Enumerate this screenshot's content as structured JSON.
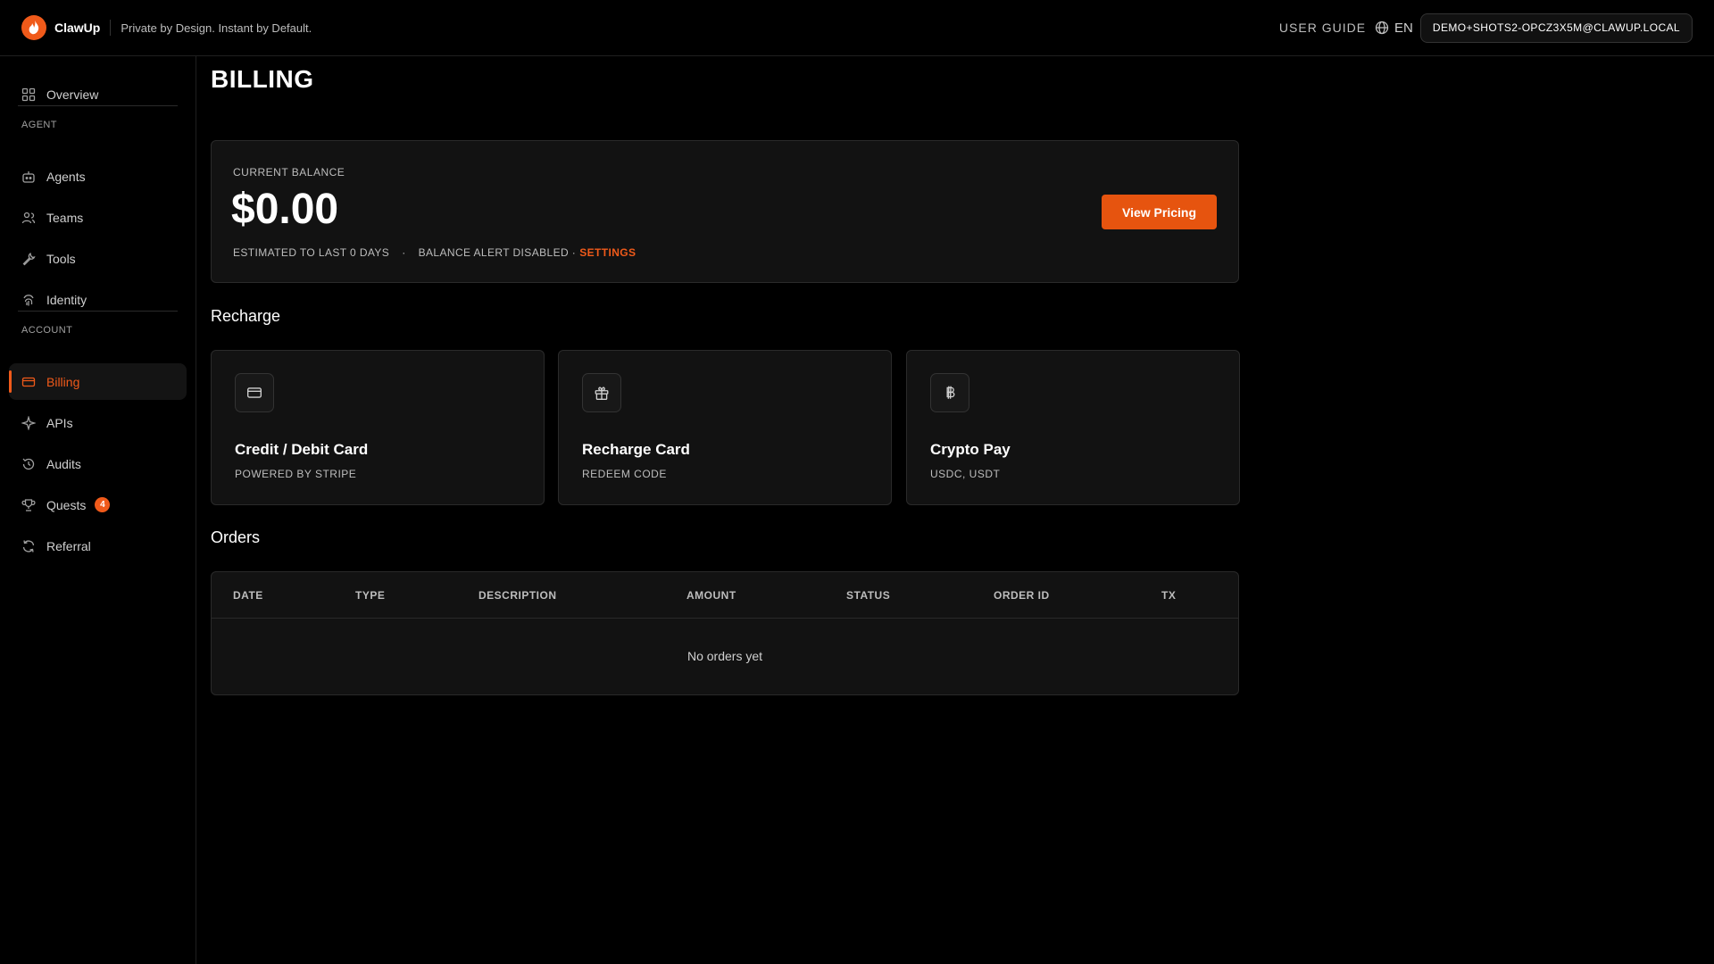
{
  "header": {
    "brand": "ClawUp",
    "tagline": "Private by Design. Instant by Default.",
    "user_guide": "USER GUIDE",
    "language": "EN",
    "account_email": "DEMO+SHOTS2-OPCZ3X5M@CLAWUP.LOCAL"
  },
  "sidebar": {
    "overview": "Overview",
    "agent_section": "AGENT",
    "agent_items": [
      "Agents",
      "Teams",
      "Tools",
      "Identity"
    ],
    "account_section": "ACCOUNT",
    "account_items": [
      "Billing",
      "APIs",
      "Audits",
      "Quests",
      "Referral"
    ],
    "quests_badge": "4",
    "active_item": "Billing"
  },
  "page": {
    "title": "BILLING",
    "balance": {
      "label": "CURRENT BALANCE",
      "amount": "$0.00",
      "estimate": "ESTIMATED TO LAST 0 DAYS",
      "dot": "·",
      "alert": "BALANCE ALERT DISABLED ·",
      "settings": "SETTINGS",
      "pricing_button": "View Pricing"
    },
    "recharge": {
      "title": "Recharge",
      "methods": [
        {
          "title": "Credit / Debit Card",
          "subtitle": "POWERED BY STRIPE",
          "icon": "credit-card-icon"
        },
        {
          "title": "Recharge Card",
          "subtitle": "REDEEM CODE",
          "icon": "gift-icon"
        },
        {
          "title": "Crypto Pay",
          "subtitle": "USDC, USDT",
          "icon": "bitcoin-icon"
        }
      ]
    },
    "orders": {
      "title": "Orders",
      "columns": [
        "DATE",
        "TYPE",
        "DESCRIPTION",
        "AMOUNT",
        "STATUS",
        "ORDER ID",
        "TX"
      ],
      "empty": "No orders yet"
    }
  },
  "colors": {
    "accent": "#f05a1a",
    "background": "#000000",
    "card": "#121212"
  }
}
